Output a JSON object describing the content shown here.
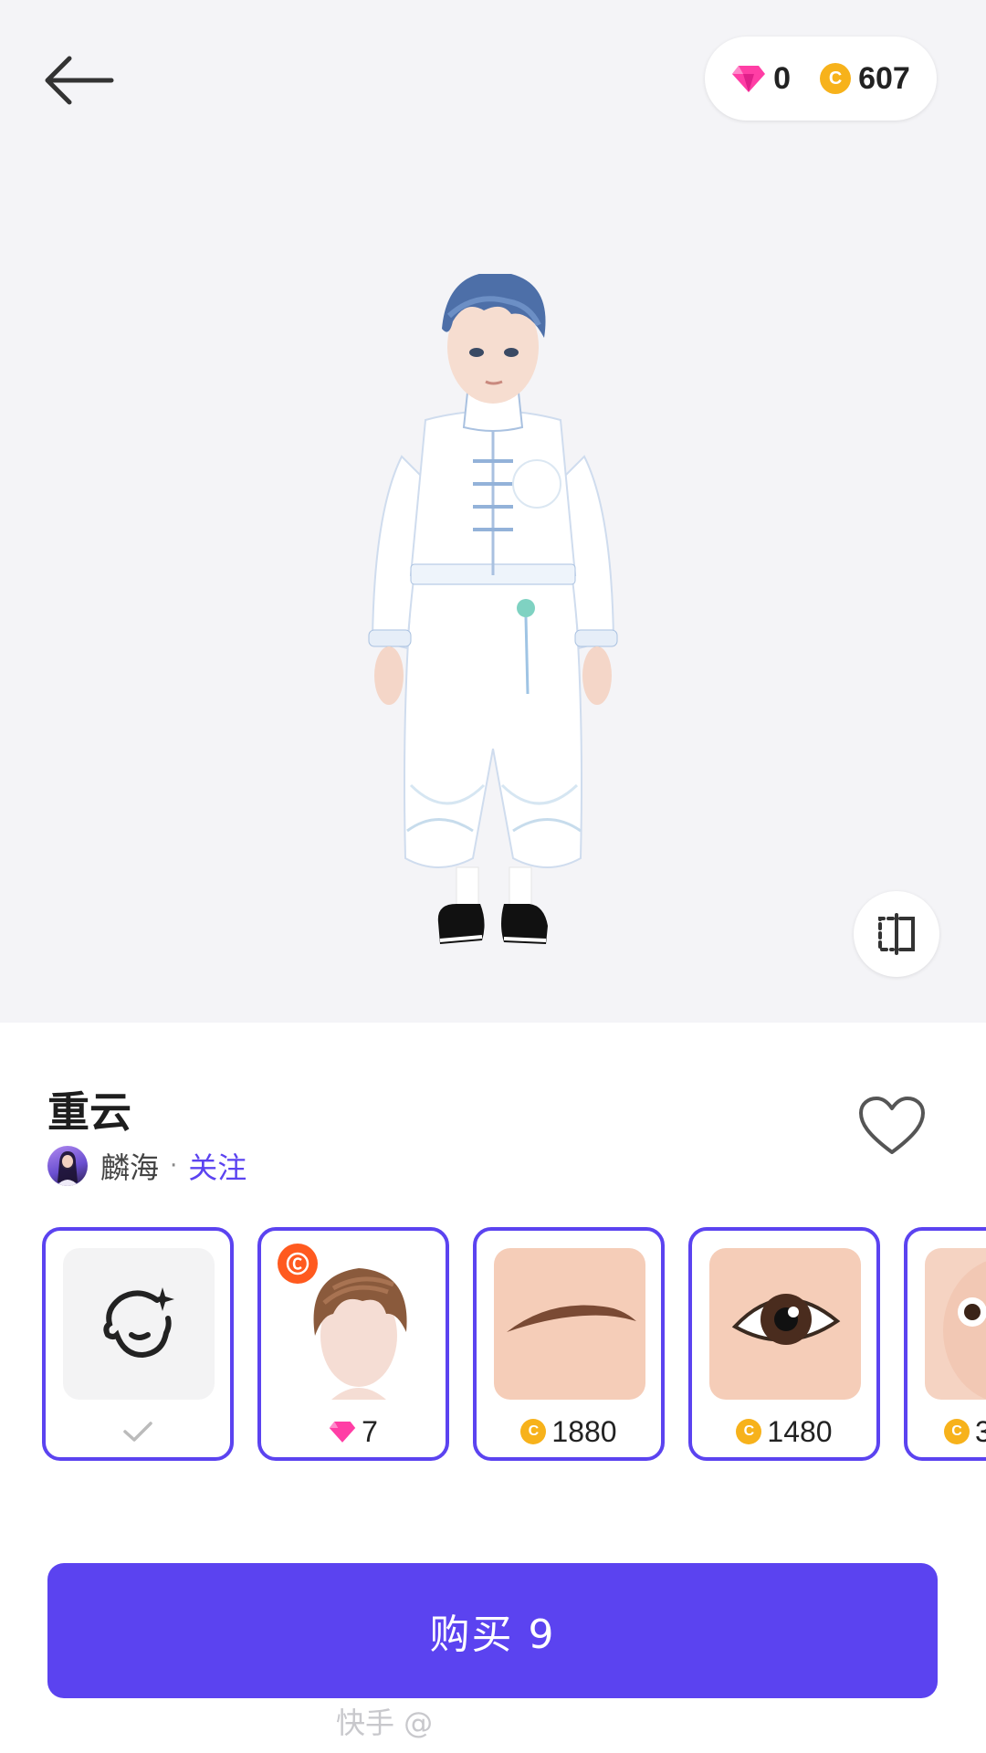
{
  "header": {
    "diamond_count": "0",
    "coin_count": "607",
    "coin_symbol": "C"
  },
  "item": {
    "title": "重云",
    "author_name": "麟海",
    "separator": "·",
    "follow_label": "关注"
  },
  "cards": [
    {
      "name": "face-template",
      "price": "",
      "currency": "none",
      "icon": "face-sparkle-icon",
      "selected": true
    },
    {
      "name": "hair",
      "price": "7",
      "currency": "diamond",
      "icon": "hair-thumbnail",
      "badge": "copyright-icon",
      "selected": true
    },
    {
      "name": "eyebrow",
      "price": "1880",
      "currency": "coin",
      "icon": "eyebrow-thumbnail",
      "selected": true
    },
    {
      "name": "eye",
      "price": "1480",
      "currency": "coin",
      "icon": "eye-thumbnail",
      "selected": true
    },
    {
      "name": "face",
      "price": "3",
      "currency": "coin",
      "icon": "face-thumbnail",
      "selected": true
    }
  ],
  "buy_button": {
    "label": "购买 9"
  },
  "watermark": "快手 @",
  "colors": {
    "accent": "#5b43f0",
    "coin": "#f7b21b",
    "diamond": "#ff3ea5",
    "badge": "#ff5a1f"
  }
}
